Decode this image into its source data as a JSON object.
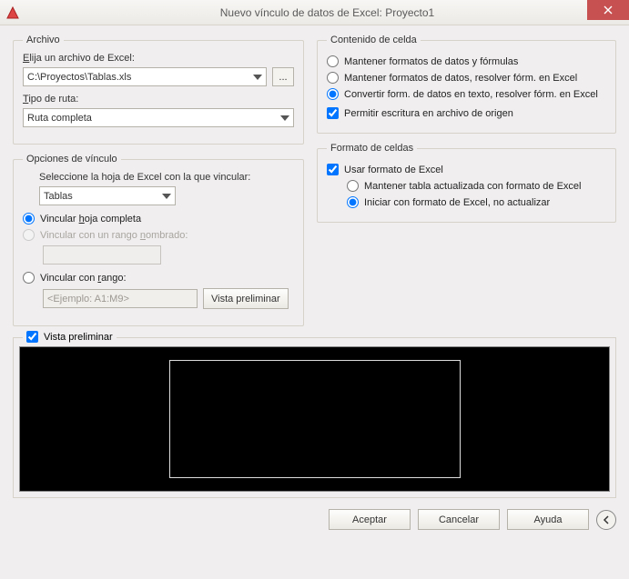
{
  "window": {
    "title": "Nuevo vínculo de datos de Excel: Proyecto1"
  },
  "archivo": {
    "legend": "Archivo",
    "choose_label": "Elija un archivo de Excel:",
    "path_value": "C:\\Proyectos\\Tablas.xls",
    "browse_label": "...",
    "tipo_ruta_label": "Tipo de ruta:",
    "tipo_ruta_value": "Ruta completa"
  },
  "opciones": {
    "legend": "Opciones de vínculo",
    "seleccione_label": "Seleccione la hoja de Excel con la que vincular:",
    "hoja_value": "Tablas",
    "vincular_hoja": "Vincular hoja completa",
    "vincular_rango_nombrado": "Vincular con un rango nombrado:",
    "vincular_rango": "Vincular con rango:",
    "rango_placeholder": "<Ejemplo: A1:M9>",
    "vista_preliminar_btn": "Vista preliminar"
  },
  "contenido": {
    "legend": "Contenido de celda",
    "mantener_formatos": "Mantener formatos de datos y fórmulas",
    "mantener_resolver": "Mantener formatos de datos, resolver fórm. en Excel",
    "convertir": "Convertir form. de datos en texto, resolver fórm. en Excel",
    "permitir_escritura": "Permitir escritura en archivo de origen"
  },
  "formato": {
    "legend": "Formato de celdas",
    "usar_formato": "Usar formato de Excel",
    "mantener_tabla": "Mantener tabla actualizada con formato de Excel",
    "iniciar_formato": "Iniciar con formato de Excel, no actualizar"
  },
  "preview": {
    "label": "Vista preliminar"
  },
  "footer": {
    "aceptar": "Aceptar",
    "cancelar": "Cancelar",
    "ayuda": "Ayuda"
  }
}
